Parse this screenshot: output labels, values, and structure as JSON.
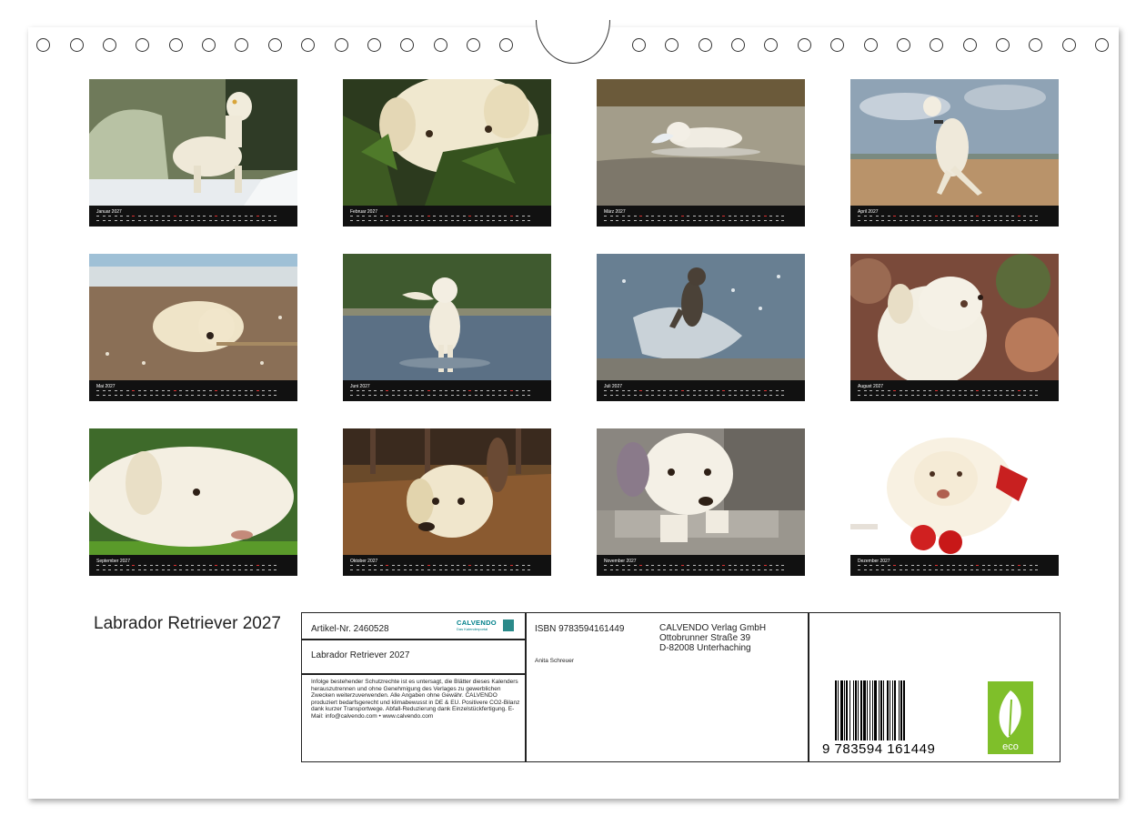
{
  "months": [
    {
      "name": "Januar 2027"
    },
    {
      "name": "Februar 2027"
    },
    {
      "name": "März 2027"
    },
    {
      "name": "April 2027"
    },
    {
      "name": "Mai 2027"
    },
    {
      "name": "Juni 2027"
    },
    {
      "name": "Juli 2027"
    },
    {
      "name": "August 2027"
    },
    {
      "name": "September 2027"
    },
    {
      "name": "Oktober 2027"
    },
    {
      "name": "November 2027"
    },
    {
      "name": "Dezember 2027"
    }
  ],
  "calendar_title": "Labrador Retriever 2027",
  "info": {
    "article_number": "Artikel-Nr. 2460528",
    "logo_text": "CALVENDO",
    "logo_sub": "Das Kalenderportal",
    "product_title": "Labrador Retriever 2027",
    "legal_text": "Infolge bestehender Schutzrechte ist es untersagt, die Blätter dieses Kalenders herauszutrennen und ohne Genehmigung des Verlages zu gewerblichen Zwecken weiterzuverwenden. Alle Angaben ohne Gewähr. CALVENDO produziert bedarfsgerecht und klimabewusst in DE & EU. Positivere CO2-Bilanz dank kurzer Transportwege. Abfall-Reduzierung dank Einzelstückfertigung. E-Mail: info@calvendo.com • www.calvendo.com",
    "isbn": "ISBN 9783594161449",
    "author": "Anita Schreuer",
    "publisher_line1": "CALVENDO Verlag GmbH",
    "publisher_line2": "Ottobrunner Straße 39",
    "publisher_line3": "D-82008 Unterhaching",
    "barcode_digits": "9 783594 161449",
    "eco_label": "eco"
  },
  "colors": {
    "strip": "#111111",
    "accent_logo": "#00808a",
    "eco_green": "#7fbf2a"
  }
}
